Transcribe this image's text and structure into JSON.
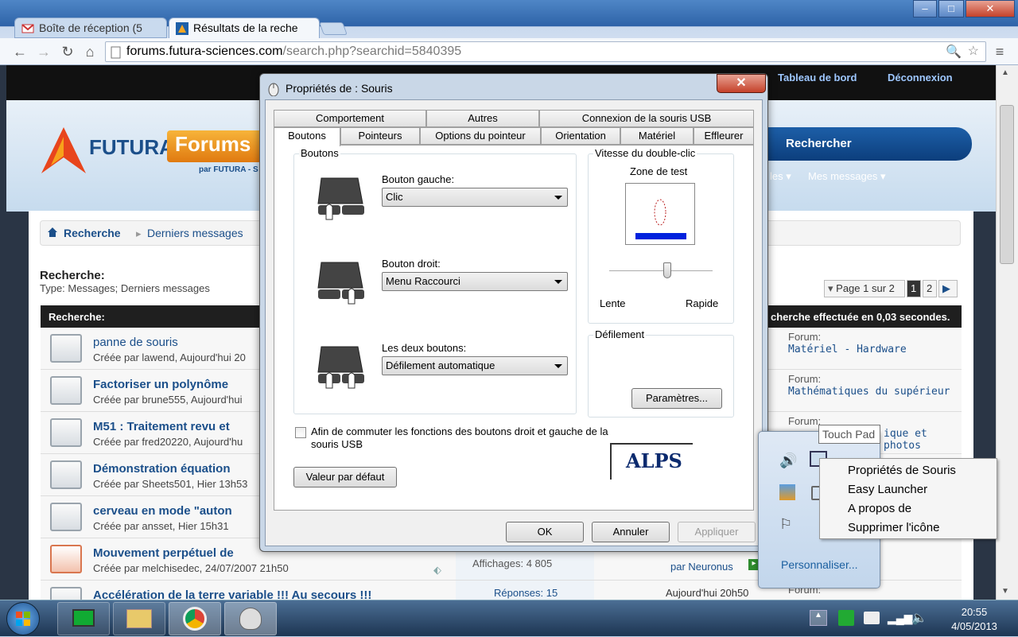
{
  "browser": {
    "tabs": [
      {
        "label": "Boîte de réception (5"
      },
      {
        "label": "Résultats de la reche"
      }
    ],
    "url_host": "forums.futura-sciences.com",
    "url_path": "/search.php?searchid=5840395"
  },
  "site": {
    "top_links": [
      "Tableau de bord",
      "Déconnexion"
    ],
    "logo_futura": "FUTURA",
    "logo_forums": "Forums",
    "logo_par": "par FUTURA - S",
    "search_button": "Rechercher",
    "nav_les": "les ▾",
    "nav_mes": "Mes messages ▾",
    "breadcrumb": [
      "Recherche",
      "Derniers messages"
    ],
    "results_title": "Recherche:",
    "results_type": "Type: Messages; Derniers messages",
    "pager": {
      "label": "Page 1 sur 2",
      "pages": [
        "1",
        "2"
      ]
    },
    "table_header_left": "Recherche:",
    "table_header_right": "cherche effectuée en 0,03 secondes.",
    "rows": [
      {
        "title": "panne de souris",
        "sub": "Créée par lawend, Aujourd'hui 20",
        "forum_label": "Forum:",
        "forum": "Matériel - Hardware"
      },
      {
        "title": "Factoriser un polynôme",
        "sub": "Créée par brune555, Aujourd'hui",
        "forum_label": "Forum:",
        "forum": "Mathématiques du supérieur"
      },
      {
        "title": "M51 : Traitement revu et",
        "sub": "Créée par fred20220, Aujourd'hu",
        "forum_label": "Forum:",
        "forum": "ique et photos"
      },
      {
        "title": "Démonstration équation",
        "sub": "Créée par Sheets501, Hier 13h53",
        "forum_label": "",
        "forum": ""
      },
      {
        "title": "cerveau en mode \"auton",
        "sub": "Créée par ansset, Hier 15h31",
        "forum_label": "",
        "forum": ""
      },
      {
        "title": "Mouvement perpétuel de",
        "sub": "Créée par melchisedec, 24/07/2007 21h50",
        "forum_label": "",
        "forum": ""
      },
      {
        "title": "Accélération de la terre variable !!! Au secours !!!",
        "sub": "",
        "forum_label": "Forum:",
        "forum": ""
      }
    ],
    "views_label": "Affichages: 4 805",
    "replies_label": "Réponses: 15",
    "by_label": "par Neuronus",
    "last_date": "Aujourd'hui 20h50"
  },
  "dialog": {
    "title": "Propriétés de : Souris",
    "close": "✕",
    "tabs_row1": [
      "Comportement",
      "Autres",
      "Connexion de la souris USB"
    ],
    "tabs_row2": [
      "Boutons",
      "Pointeurs",
      "Options du pointeur",
      "Orientation",
      "Matériel",
      "Effleurer"
    ],
    "group_buttons": "Boutons",
    "left_label": "Bouton gauche:",
    "left_value": "Clic",
    "right_label": "Bouton droit:",
    "right_value": "Menu Raccourci",
    "both_label": "Les deux boutons:",
    "both_value": "Défilement automatique",
    "group_speed": "Vitesse du double-clic",
    "test_zone": "Zone de test",
    "slow": "Lente",
    "fast": "Rapide",
    "group_scroll": "Défilement",
    "params_button": "Paramètres...",
    "swap_checkbox": "Afin de commuter les fonctions des boutons droit et gauche de la souris USB",
    "default_button": "Valeur par défaut",
    "alps": "ALPS",
    "ok": "OK",
    "cancel": "Annuler",
    "apply": "Appliquer"
  },
  "tray": {
    "tooltip": "Touch Pad",
    "menu": [
      "Propriétés de Souris",
      "Easy Launcher",
      "A propos de",
      "Supprimer l'icône"
    ],
    "personalize": "Personnaliser..."
  },
  "taskbar": {
    "time": "20:55",
    "date": "4/05/2013"
  }
}
